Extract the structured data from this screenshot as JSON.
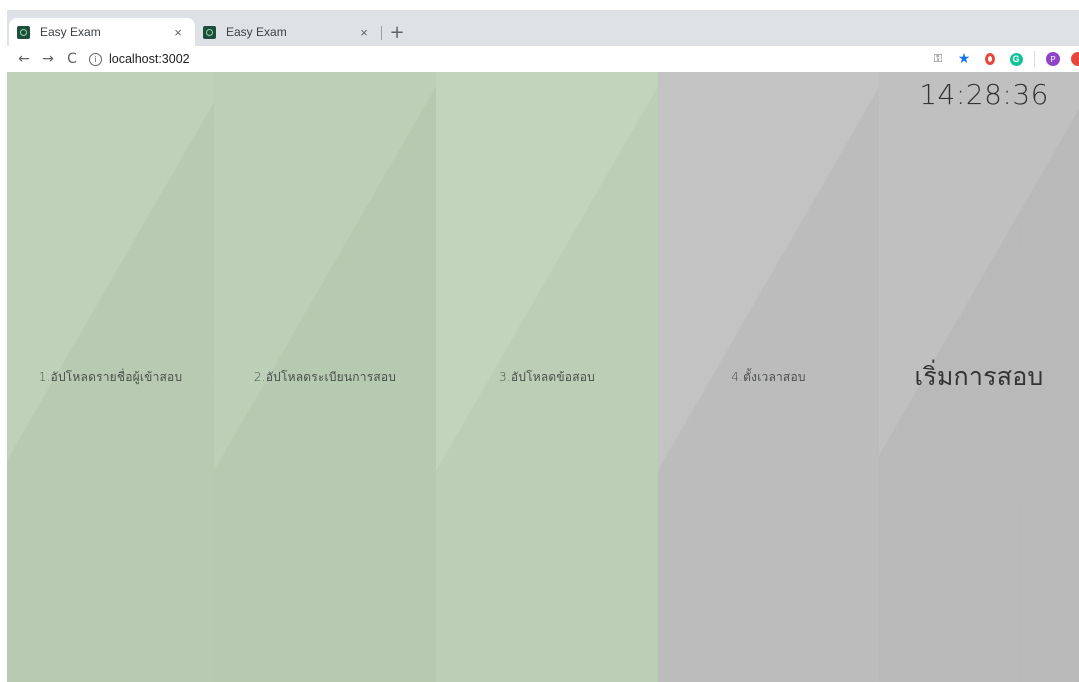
{
  "browser": {
    "tabs": [
      {
        "title": "Easy Exam",
        "close": "×",
        "active": true
      },
      {
        "title": "Easy Exam",
        "close": "×",
        "active": false
      }
    ],
    "new_tab": "+",
    "nav": {
      "back": "←",
      "forward": "→",
      "reload": "C"
    },
    "address": "localhost:3002",
    "profile_initial": "P",
    "grammarly_initial": "G"
  },
  "app": {
    "clock": "14:28:36",
    "panels": [
      {
        "label": "1.อัปโหลดรายชื่อผู้เข้าสอบ",
        "color": "#bccfb5"
      },
      {
        "label": "2.อัปโหลดระเบียนการสอบ",
        "color": "#b9ceb4"
      },
      {
        "label": "3.อัปโหลดข้อสอบ",
        "color": "#c0d2b9"
      },
      {
        "label": "4.ตั้งเวลาสอบ",
        "color": "#c0c0c0"
      },
      {
        "label": "เริ่มการสอบ",
        "color": "#bdbdbd"
      }
    ]
  }
}
